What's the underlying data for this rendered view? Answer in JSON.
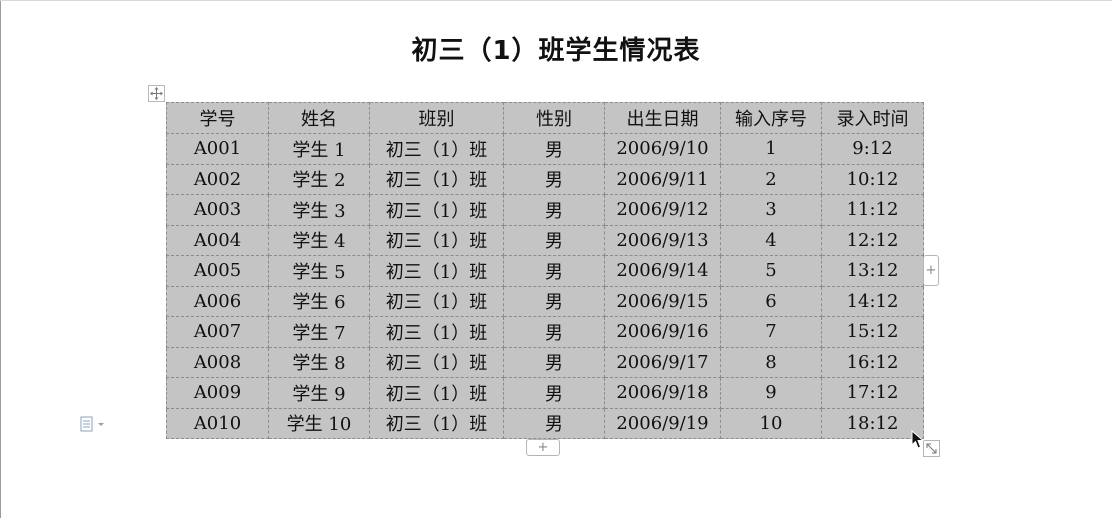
{
  "document": {
    "title": "初三（1）班学生情况表"
  },
  "table": {
    "headers": [
      "学号",
      "姓名",
      "班别",
      "性别",
      "出生日期",
      "输入序号",
      "录入时间"
    ],
    "rows": [
      [
        "A001",
        "学生 1",
        "初三（1）班",
        "男",
        "2006/9/10",
        "1",
        "9:12"
      ],
      [
        "A002",
        "学生 2",
        "初三（1）班",
        "男",
        "2006/9/11",
        "2",
        "10:12"
      ],
      [
        "A003",
        "学生 3",
        "初三（1）班",
        "男",
        "2006/9/12",
        "3",
        "11:12"
      ],
      [
        "A004",
        "学生 4",
        "初三（1）班",
        "男",
        "2006/9/13",
        "4",
        "12:12"
      ],
      [
        "A005",
        "学生 5",
        "初三（1）班",
        "男",
        "2006/9/14",
        "5",
        "13:12"
      ],
      [
        "A006",
        "学生 6",
        "初三（1）班",
        "男",
        "2006/9/15",
        "6",
        "14:12"
      ],
      [
        "A007",
        "学生 7",
        "初三（1）班",
        "男",
        "2006/9/16",
        "7",
        "15:12"
      ],
      [
        "A008",
        "学生 8",
        "初三（1）班",
        "男",
        "2006/9/17",
        "8",
        "16:12"
      ],
      [
        "A009",
        "学生 9",
        "初三（1）班",
        "男",
        "2006/9/18",
        "9",
        "17:12"
      ],
      [
        "A010",
        "学生 10",
        "初三（1）班",
        "男",
        "2006/9/19",
        "10",
        "18:12"
      ]
    ],
    "background_color": "#c4c4c4"
  },
  "controls": {
    "add_column_label": "+",
    "add_row_label": "+",
    "move_icon": "move-icon",
    "resize_icon": "resize-icon",
    "paste_options_icon": "paste-options-icon"
  }
}
